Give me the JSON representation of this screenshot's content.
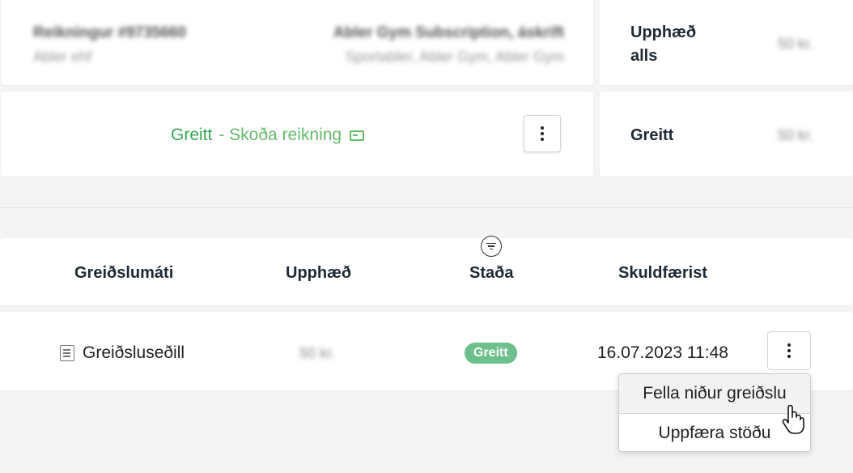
{
  "invoice": {
    "number": "Reikningur #9735660",
    "customer": "Abler ehf",
    "subscription": "Abler Gym Subscription, áskrift",
    "products": "Sportabler, Abler Gym, Abler Gym"
  },
  "summary": {
    "total_label": "Upphæð alls",
    "total_value": "50 kr.",
    "paid_label": "Greitt",
    "paid_value": "50 kr."
  },
  "status_row": {
    "status": "Greitt",
    "view_invoice": "- Skoða reikning"
  },
  "table": {
    "headers": [
      "Greiðslumáti",
      "Upphæð",
      "Staða",
      "Skuldfærist"
    ],
    "rows": [
      {
        "method": "Greiðsluseðill",
        "amount": "50 kr.",
        "status": "Greitt",
        "charge_date": "16.07.2023 11:48"
      }
    ]
  },
  "dropdown_menu": {
    "items": [
      "Fella niður greiðslu",
      "Uppfæra stöðu"
    ]
  },
  "icons": [
    "receipt-icon",
    "more-vertical-icon",
    "filter-icon",
    "invoice-document-icon",
    "hand-pointer-cursor"
  ],
  "colors": {
    "paid_green": "#34a853",
    "link_green": "#66bb6a",
    "badge_green": "#6dbf8b"
  }
}
